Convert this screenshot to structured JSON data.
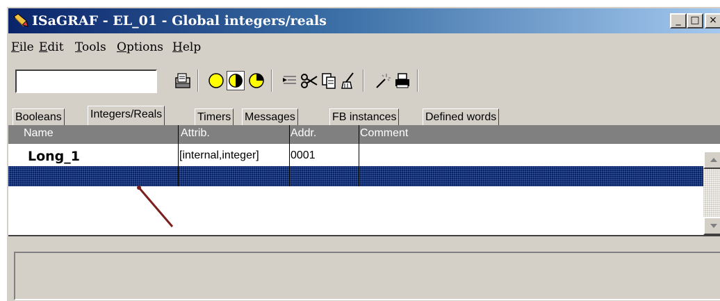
{
  "window": {
    "title": "ISaGRAF - EL_01 - Global integers/reals",
    "minimize_glyph": "_",
    "maximize_glyph": "□",
    "close_glyph": "×"
  },
  "menu": {
    "items": [
      {
        "underline": "F",
        "rest": "ile"
      },
      {
        "underline": "E",
        "rest": "dit"
      },
      {
        "underline": "T",
        "rest": "ools"
      },
      {
        "underline": "O",
        "rest": "ptions"
      },
      {
        "underline": "H",
        "rest": "elp"
      }
    ]
  },
  "toolbar": {
    "search_value": "",
    "buttons": [
      "open-icon",
      "circle-empty-icon",
      "circle-half-icon",
      "circle-quarter-icon",
      "insert-icon",
      "cut-icon",
      "copy-icon",
      "clear-icon",
      "wand-icon",
      "print-icon"
    ]
  },
  "tabs": [
    {
      "label": "Booleans",
      "active": false
    },
    {
      "label": "Integers/Reals",
      "active": true
    },
    {
      "label": "Timers",
      "active": false
    },
    {
      "label": "Messages",
      "active": false
    },
    {
      "label": "FB instances",
      "active": false
    },
    {
      "label": "Defined words",
      "active": false
    }
  ],
  "grid": {
    "columns": [
      "Name",
      "Attrib.",
      "Addr.",
      "Comment"
    ],
    "rows": [
      {
        "name": "Long_1",
        "attrib": "[internal,integer]",
        "addr": "0001",
        "comment": ""
      }
    ]
  },
  "colors": {
    "title_start": "#0a246a",
    "title_end": "#a6caf0",
    "selection": "#0a246a",
    "face": "#d4d0c8",
    "pointer": "#7b1f1f"
  }
}
